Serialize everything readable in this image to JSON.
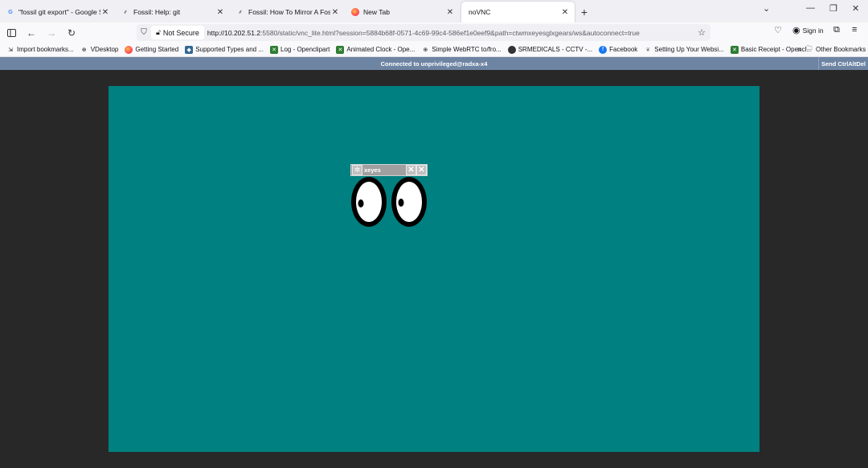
{
  "tabs": [
    {
      "title": "\"fossil git export\" - Google Search",
      "favicon": "google-icon",
      "active": false
    },
    {
      "title": "Fossil: Help: git",
      "favicon": "fossil-icon",
      "active": false
    },
    {
      "title": "Fossil: How To Mirror A Fossil Repository",
      "favicon": "fossil-icon",
      "active": false
    },
    {
      "title": "New Tab",
      "favicon": "firefox-icon",
      "active": false
    },
    {
      "title": "noVNC",
      "favicon": "",
      "active": true
    }
  ],
  "navbar": {
    "security_label": "Not Secure",
    "url_host": "http://10.202.51.2",
    "url_rest": ":5580/static/vnc_lite.html?session=5884b68f-0571-4c69-99c4-586ef1e0eef9&path=ctwmxeyesglxgears/ws&autoconnect=true",
    "sign_in_label": "Sign in"
  },
  "bookmarks": [
    {
      "label": "Import bookmarks...",
      "icon": "import-icon"
    },
    {
      "label": "VDesktop",
      "icon": "globe-icon"
    },
    {
      "label": "Getting Started",
      "icon": "firefox-icon"
    },
    {
      "label": "Supported Types and ...",
      "icon": "db-icon"
    },
    {
      "label": "Log - Openclipart",
      "icon": "x-icon"
    },
    {
      "label": "Animated Clock - Ope...",
      "icon": "x-icon"
    },
    {
      "label": "Simple WebRTC to/fro...",
      "icon": "globe-icon"
    },
    {
      "label": "SRMEDICALS - CCTV -...",
      "icon": "circle-icon"
    },
    {
      "label": "Facebook",
      "icon": "facebook-icon"
    },
    {
      "label": "Setting Up Your Websi...",
      "icon": "leaf-icon"
    },
    {
      "label": "Basic Receipt - Opencl...",
      "icon": "x-icon"
    }
  ],
  "other_bookmarks_label": "Other Bookmarks",
  "vnc": {
    "status": "Connected to unprivileged@radxa-x4",
    "send_cad_label": "Send CtrlAltDel"
  },
  "xeyes": {
    "title": "xeyes"
  },
  "colors": {
    "desktop": "#008080",
    "vnc_bar": "#6e84a3",
    "vnc_bg": "#282828"
  }
}
